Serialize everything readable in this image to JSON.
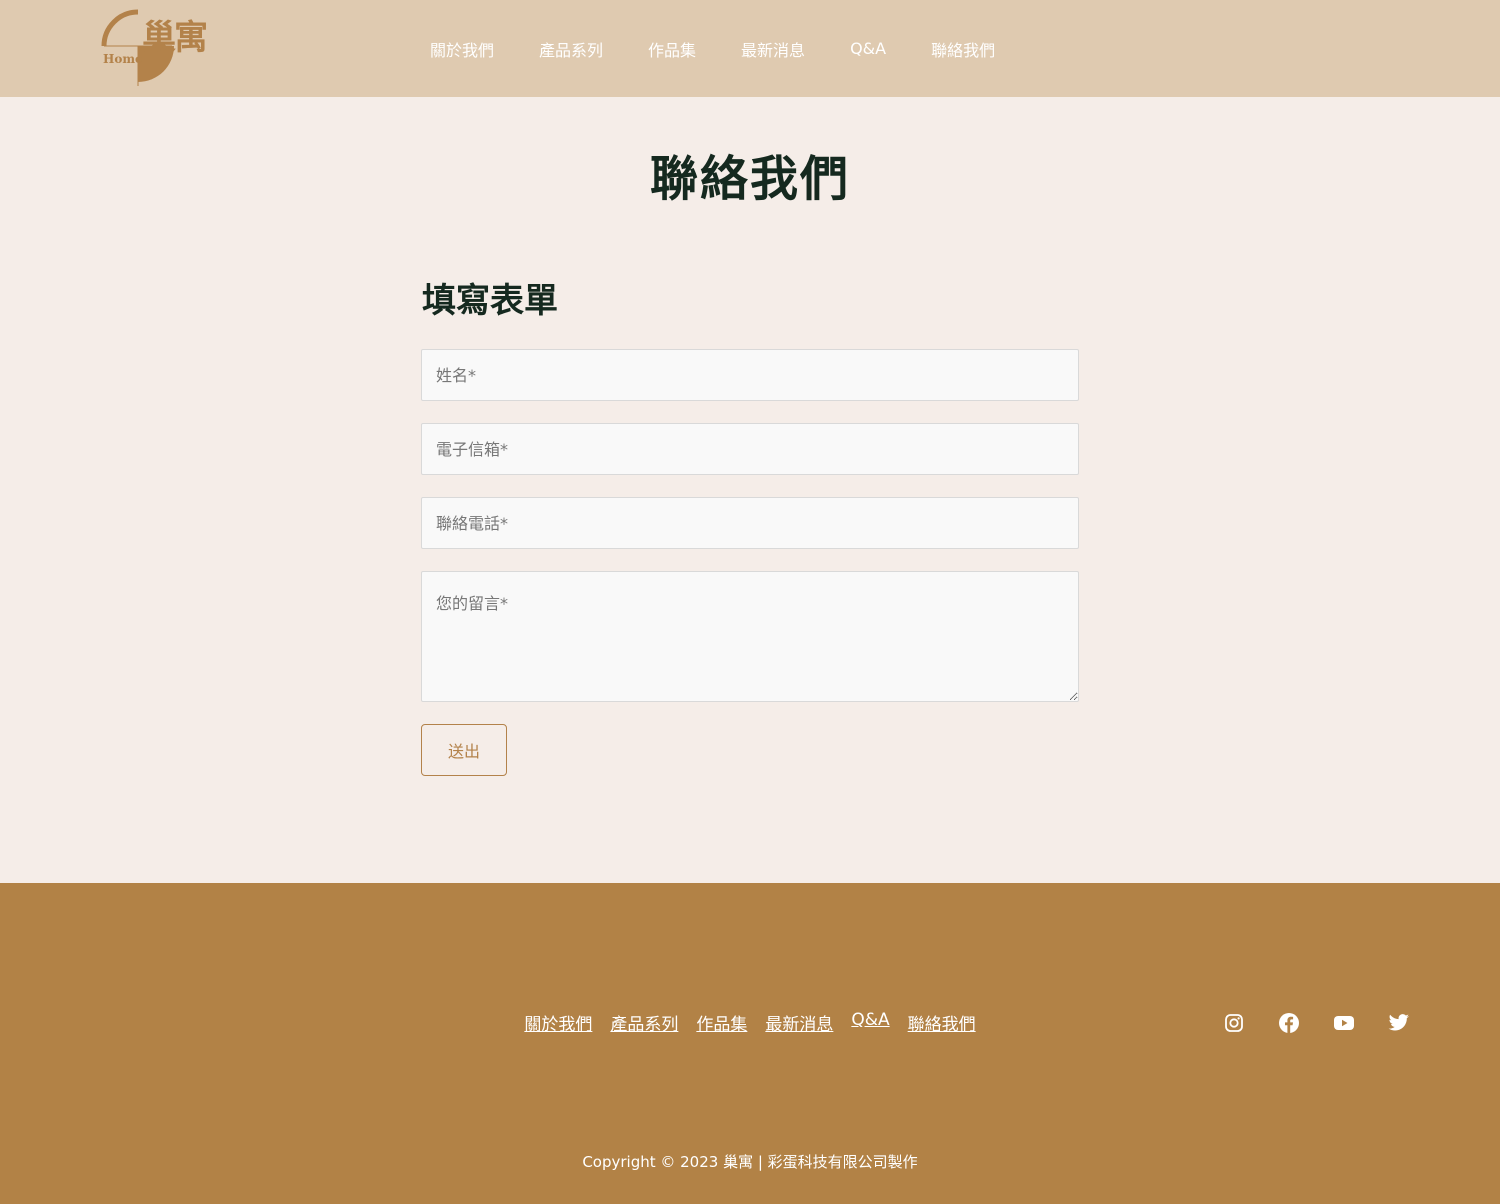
{
  "header": {
    "logo_text": "巢寓",
    "logo_home": "Home",
    "nav": [
      "關於我們",
      "產品系列",
      "作品集",
      "最新消息",
      "Q&A",
      "聯絡我們"
    ]
  },
  "main": {
    "title": "聯絡我們",
    "form_title": "填寫表單",
    "fields": {
      "name_placeholder": "姓名*",
      "email_placeholder": "電子信箱*",
      "phone_placeholder": "聯絡電話*",
      "message_placeholder": "您的留言*"
    },
    "submit_label": "送出"
  },
  "footer": {
    "nav": [
      "關於我們",
      "產品系列",
      "作品集",
      "最新消息",
      "Q&A",
      "聯絡我們"
    ],
    "social": [
      "instagram-icon",
      "facebook-icon",
      "youtube-icon",
      "twitter-icon"
    ],
    "copyright": "Copyright © 2023 巢寓 | 彩蛋科技有限公司製作"
  },
  "colors": {
    "header_bg": "#dfcab0",
    "main_bg": "#f5ede8",
    "footer_bg": "#b28246",
    "accent": "#b3824a",
    "title": "#15291f"
  }
}
